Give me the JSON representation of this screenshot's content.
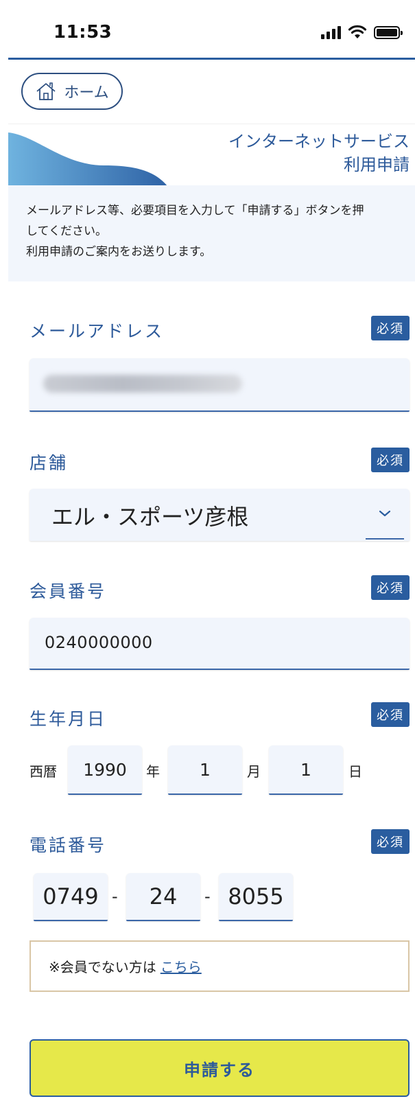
{
  "status_bar": {
    "time": "11:53"
  },
  "home_button": {
    "label": "ホーム"
  },
  "banner": {
    "title_line1": "インターネットサービス",
    "title_line2": "利用申請"
  },
  "info": {
    "line1": "メールアドレス等、必要項目を入力して「申請する」ボタンを押",
    "line2": "してください。",
    "line3": "利用申請のご案内をお送りします。"
  },
  "required_label": "必須",
  "form": {
    "email": {
      "label": "メールアドレス",
      "value": ""
    },
    "store": {
      "label": "店舗",
      "value": "エル・スポーツ彦根"
    },
    "member_no": {
      "label": "会員番号",
      "value": "0240000000"
    },
    "birthdate": {
      "label": "生年月日",
      "prefix": "西暦",
      "year": "1990",
      "year_unit": "年",
      "month": "1",
      "month_unit": "月",
      "day": "1",
      "day_unit": "日"
    },
    "phone": {
      "label": "電話番号",
      "part1": "0749",
      "part2": "24",
      "part3": "8055",
      "separator": "-"
    }
  },
  "notice": {
    "text": "※会員でない方は",
    "link": "こちら"
  },
  "submit": {
    "label": "申請する"
  },
  "colors": {
    "accent": "#2a5d9f",
    "submit_bg": "#e6e84a",
    "input_bg": "#f1f5fc"
  }
}
